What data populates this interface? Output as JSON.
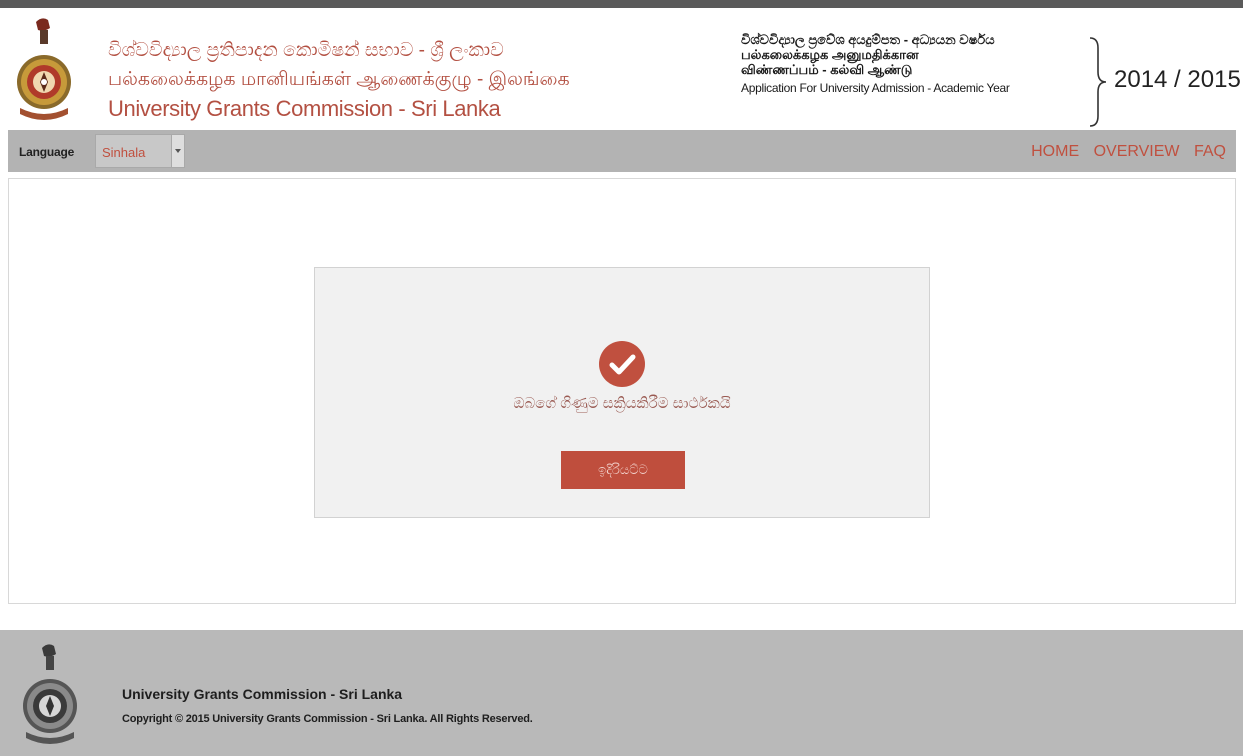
{
  "header": {
    "org_name_sinhala": "විශ්වවිද්‍යාල ප්‍රතිපාදන කොමිෂන් සභාව - ශ්‍රී ලංකාව",
    "org_name_tamil": "பல்கலைக்கழக மானியங்கள் ஆணைக்குழு - இலங்கை",
    "org_name_english": "University Grants Commission - Sri Lanka",
    "app_title_sinhala": "විශ්වවිද්‍යාල ප්‍රවේශ අයදුම්පත - අධ්‍යයන වර්ෂය",
    "app_title_tamil_1": "பல்கலைக்கழக அனுமதிக்கான",
    "app_title_tamil_2": "விண்ணப்பம் - கல்வி ஆண்டு",
    "app_title_english": "Application For University Admission - Academic Year",
    "academic_year": "2014 / 2015"
  },
  "navbar": {
    "language_label": "Language",
    "language_selected": "Sinhala",
    "links": [
      "HOME",
      "OVERVIEW",
      "FAQ"
    ]
  },
  "main": {
    "success_message": "ඔබගේ ගිණුම සක්‍රියකිරීම සාර්ථකයි",
    "continue_button": "ඉදිරියට්ට"
  },
  "footer": {
    "title": "University Grants Commission - Sri Lanka",
    "copyright": "Copyright © 2015 University Grants Commission - Sri Lanka. All Rights Reserved."
  },
  "colors": {
    "accent": "#c0503f",
    "nav_bg": "#b3b3b3",
    "footer_bg": "#b9b9b9"
  }
}
